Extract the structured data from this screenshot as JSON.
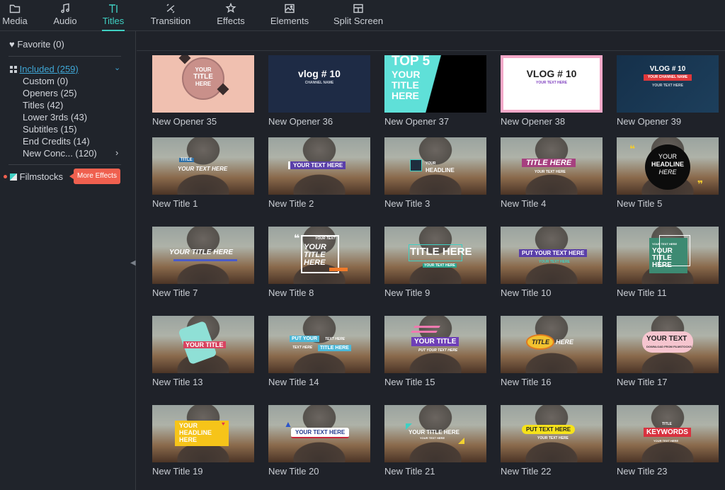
{
  "tabs": [
    {
      "label": "Media",
      "icon": "folder-icon"
    },
    {
      "label": "Audio",
      "icon": "music-note-icon"
    },
    {
      "label": "Titles",
      "icon": "text-icon"
    },
    {
      "label": "Transition",
      "icon": "transition-icon"
    },
    {
      "label": "Effects",
      "icon": "effects-icon"
    },
    {
      "label": "Elements",
      "icon": "image-icon"
    },
    {
      "label": "Split Screen",
      "icon": "split-screen-icon"
    }
  ],
  "active_tab": "Titles",
  "accent_color": "#3fd0c3",
  "sidebar": {
    "favorite": "Favorite (0)",
    "included": "Included (259)",
    "categories": [
      "Custom (0)",
      "Openers (25)",
      "Titles (42)",
      "Lower 3rds (43)",
      "Subtitles (15)",
      "End Credits (14)",
      "New Conc... (120)"
    ],
    "filmstocks": "Filmstocks",
    "badge": "More Effects"
  },
  "cards": [
    {
      "label": "New Opener 35",
      "thumb_text": [
        "YOUR",
        "TITLE",
        "HERE"
      ]
    },
    {
      "label": "New Opener 36",
      "thumb_text": [
        "vlog # 10",
        "CHANNEL NAME"
      ]
    },
    {
      "label": "New Opener 37",
      "thumb_text": [
        "TOP 5",
        "YOUR",
        "TITLE",
        "HERE"
      ]
    },
    {
      "label": "New Opener 38",
      "thumb_text": [
        "VLOG # 10",
        "YOUR TEXT HERE"
      ]
    },
    {
      "label": "New Opener 39",
      "thumb_text": [
        "VLOG # 10",
        "YOUR CHANNEL NAME",
        "YOUR TEXT HERE"
      ]
    },
    {
      "label": "New Title 1",
      "thumb_text": [
        "TITLE",
        "YOUR TEXT HERE"
      ]
    },
    {
      "label": "New Title 2",
      "thumb_text": [
        "YOUR TEXT HERE"
      ]
    },
    {
      "label": "New Title 3",
      "thumb_text": [
        "YOUR",
        "HEADLINE"
      ]
    },
    {
      "label": "New Title 4",
      "thumb_text": [
        "TITLE HERE",
        "YOUR TEXT HERE"
      ]
    },
    {
      "label": "New Title 5",
      "thumb_text": [
        "YOUR",
        "HEADLINE",
        "HERE"
      ]
    },
    {
      "label": "New Title 7",
      "thumb_text": [
        "YOUR TITLE HERE"
      ]
    },
    {
      "label": "New Title 8",
      "thumb_text": [
        "YOUR TEXT",
        "YOUR",
        "TITLE",
        "HERE"
      ]
    },
    {
      "label": "New Title 9",
      "thumb_text": [
        "TITLE HERE",
        "YOUR TEXT HERE"
      ]
    },
    {
      "label": "New Title 10",
      "thumb_text": [
        "PUT YOUR TEXT HERE",
        "YOUR TEXT HERE"
      ]
    },
    {
      "label": "New Title 11",
      "thumb_text": [
        "YOUR TEXT HERE",
        "YOUR",
        "TITLE",
        "HERE"
      ]
    },
    {
      "label": "New Title 13",
      "thumb_text": [
        "YOUR TITLE"
      ]
    },
    {
      "label": "New Title 14",
      "thumb_text": [
        "PUT YOUR",
        "TEXT HERE",
        "TEXT HERE",
        "TITLE HERE"
      ]
    },
    {
      "label": "New Title 15",
      "thumb_text": [
        "YOUR TITLE",
        "PUT YOUR TEXT HERE"
      ]
    },
    {
      "label": "New Title 16",
      "thumb_text": [
        "TITLE",
        "HERE"
      ]
    },
    {
      "label": "New Title 17",
      "thumb_text": [
        "YOUR TEXT",
        "DOWNLOAD FROM FILMSTOCKS"
      ]
    },
    {
      "label": "New Title 19",
      "thumb_text": [
        "YOUR",
        "HEADLINE",
        "HERE"
      ]
    },
    {
      "label": "New Title 20",
      "thumb_text": [
        "YOUR TEXT HERE"
      ]
    },
    {
      "label": "New Title 21",
      "thumb_text": [
        "YOUR TITLE HERE",
        "YOUR TEXT HERE"
      ]
    },
    {
      "label": "New Title 22",
      "thumb_text": [
        "PUT TEXT HERE",
        "YOUR TEXT HERE"
      ]
    },
    {
      "label": "New Title 23",
      "thumb_text": [
        "TITLE",
        "KEYWORDS",
        "YOUR TEXT HERE"
      ]
    }
  ]
}
